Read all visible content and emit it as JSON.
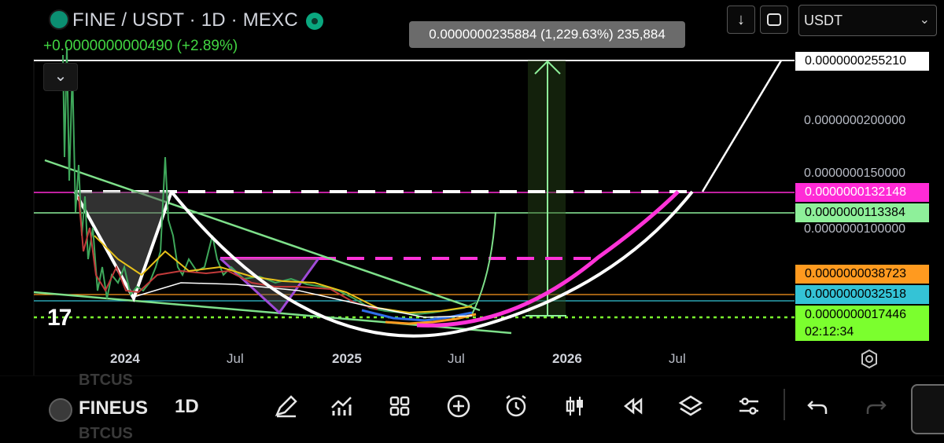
{
  "header": {
    "title": "FINE / USDT · 1D · MEXC",
    "change": "+0.0000000000490 (+2.89%)",
    "collapse_glyph": "⌄"
  },
  "tooltip": {
    "text": "0.0000000235884 (1,229.63%) 235,884"
  },
  "top_buttons": {
    "down_glyph": "↓",
    "currency_value": "USDT",
    "currency_chevron": "⌄"
  },
  "colors": {
    "background": "#000000",
    "white_tag": "#ffffff",
    "magenta_tag": "#ff2bd6",
    "light_green_tag": "#8ef09a",
    "orange_tag": "#ff9a1f",
    "teal_tag": "#34c3d6",
    "bright_green_tag": "#7bff2e",
    "pattern_magenta": "#ff33d8",
    "pattern_white": "#ffffff",
    "trend_green": "#7ee08a"
  },
  "price_axis": {
    "labels": [
      "0.0000000200000",
      "0.0000000150000",
      "0.0000000100000"
    ],
    "tags": [
      {
        "value": "0.0000000255210",
        "style": "white"
      },
      {
        "value": "0.0000000132148",
        "style": "magenta"
      },
      {
        "value": "0.0000000113384",
        "style": "lightgreen"
      },
      {
        "value": "0.0000000038723",
        "style": "orange"
      },
      {
        "value": "0.0000000032518",
        "style": "teal"
      },
      {
        "value": "0.0000000017446",
        "style": "green"
      }
    ],
    "countdown": "02:12:34"
  },
  "time_axis": {
    "labels": [
      {
        "text": "2024",
        "bold": true
      },
      {
        "text": "Jul",
        "bold": false
      },
      {
        "text": "2025",
        "bold": true
      },
      {
        "text": "Jul",
        "bold": false
      },
      {
        "text": "2026",
        "bold": true
      },
      {
        "text": "Jul",
        "bold": false
      }
    ]
  },
  "toolbar": {
    "symbol": "FINEUS",
    "interval": "1D",
    "ghost_symbol_top": "BTCUS",
    "ghost_symbol_bottom": "BTCUS",
    "icons": [
      "pen-icon",
      "indicators-icon",
      "grid-icon",
      "add-icon",
      "alarm-icon",
      "candles-icon",
      "replay-icon",
      "layers-icon",
      "settings-icon",
      "undo-icon",
      "redo-icon"
    ]
  }
}
